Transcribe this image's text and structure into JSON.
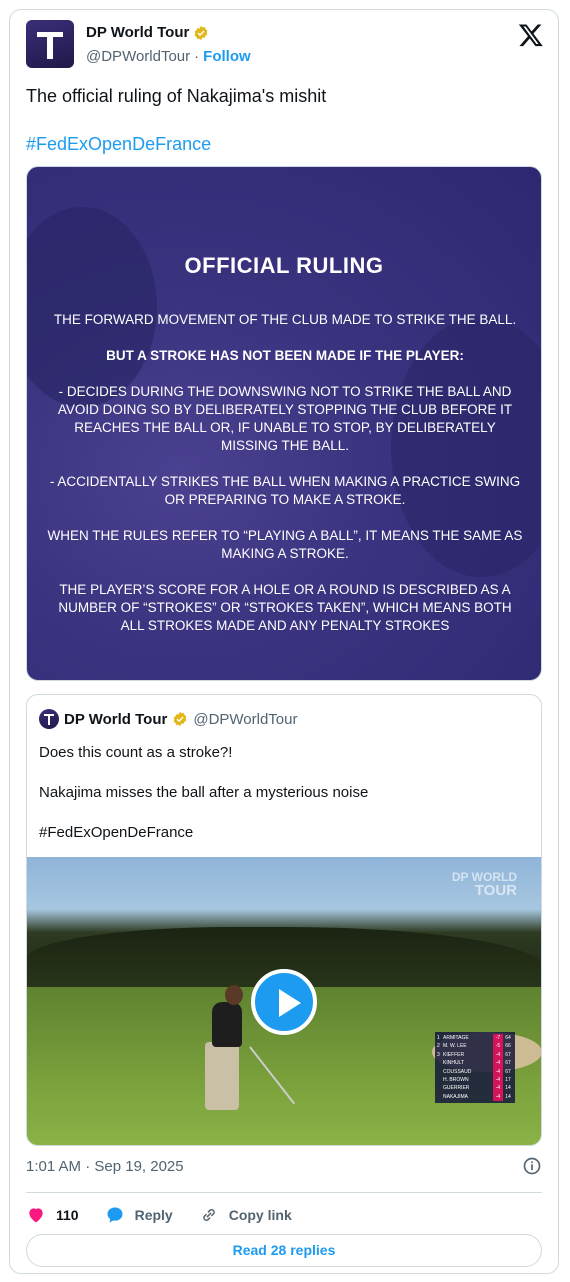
{
  "header": {
    "name": "DP World Tour",
    "handle": "@DPWorldTour",
    "separator": "·",
    "follow_label": "Follow"
  },
  "tweet": {
    "text": "The official ruling of Nakajima's mishit",
    "hashtag": "#FedExOpenDeFrance"
  },
  "ruling": {
    "title": "OFFICIAL RULING",
    "paragraphs": [
      "THE FORWARD MOVEMENT OF THE CLUB MADE TO STRIKE THE BALL.",
      "BUT A STROKE HAS NOT BEEN MADE IF THE PLAYER:",
      "- DECIDES DURING THE DOWNSWING NOT TO STRIKE THE BALL AND AVOID DOING SO BY DELIBERATELY STOPPING THE CLUB BEFORE IT REACHES THE BALL OR, IF UNABLE TO STOP, BY DELIBERATELY MISSING THE BALL.",
      "- ACCIDENTALLY STRIKES THE BALL WHEN MAKING A PRACTICE SWING OR PREPARING TO MAKE A STROKE.",
      "WHEN THE RULES REFER TO “PLAYING A BALL”, IT MEANS THE SAME AS MAKING A STROKE.",
      "THE PLAYER’S SCORE FOR A HOLE OR A ROUND IS DESCRIBED AS A NUMBER OF “STROKES” OR “STROKES TAKEN”, WHICH MEANS BOTH ALL STROKES MADE AND ANY PENALTY STROKES"
    ]
  },
  "quote": {
    "name": "DP World Tour",
    "handle": "@DPWorldTour",
    "line1": "Does this count as a stroke?!",
    "line2": "Nakajima misses the ball after a mysterious noise",
    "line3": "#FedExOpenDeFrance",
    "watermark_line1": "DP WORLD",
    "watermark_line2": "TOUR",
    "leaderboard": [
      {
        "pos": "1",
        "player": "ARMITAGE",
        "score": "-7",
        "round": "64"
      },
      {
        "pos": "2",
        "player": "M. W. LEE",
        "score": "-5",
        "round": "66"
      },
      {
        "pos": "3",
        "player": "KIEFFER",
        "score": "-4",
        "round": "67"
      },
      {
        "pos": "",
        "player": "KINHULT",
        "score": "-4",
        "round": "67"
      },
      {
        "pos": "",
        "player": "COUSSAUD",
        "score": "-4",
        "round": "67"
      },
      {
        "pos": "",
        "player": "H. BROWN",
        "score": "-4",
        "round": "17"
      },
      {
        "pos": "",
        "player": "GUERRIER",
        "score": "-4",
        "round": "14"
      },
      {
        "pos": "",
        "player": "NAKAJIMA",
        "score": "-4",
        "round": "14"
      }
    ]
  },
  "meta": {
    "timestamp": "1:01 AM · Sep 19, 2025"
  },
  "actions": {
    "likes": "110",
    "reply": "Reply",
    "copy_link": "Copy link"
  },
  "read_replies": "Read 28 replies",
  "colors": {
    "link": "#1d9bf0",
    "heart": "#f91880",
    "verified": "#e2b719",
    "text_secondary": "#536471"
  }
}
